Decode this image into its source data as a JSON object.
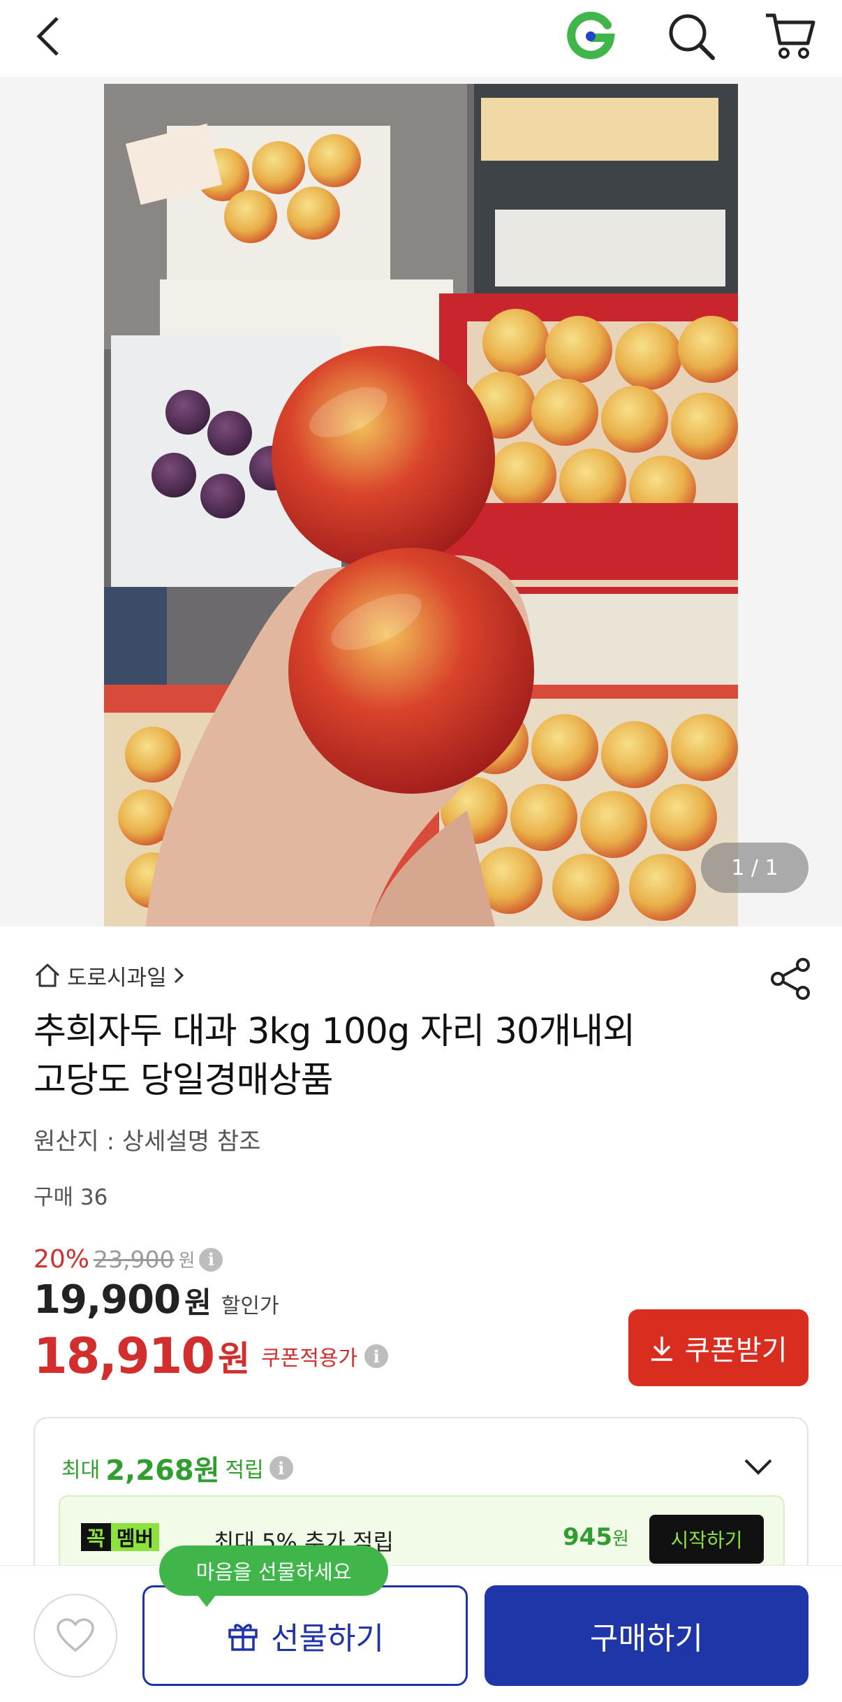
{
  "header": {
    "back_icon": "chevron-left-icon",
    "logo_icon": "g-logo-icon",
    "search_icon": "search-icon",
    "cart_icon": "cart-icon",
    "logo_color": "#3fb54a"
  },
  "gallery": {
    "counter": "1 / 1"
  },
  "product": {
    "seller": "도로시과일",
    "title_line1": "추희자두 대과 3kg 100g 자리 30개내외",
    "title_line2": "고당도 당일경매상품",
    "origin": "원산지 : 상세설명 참조",
    "purchases": "구매 36"
  },
  "price": {
    "discount_rate": "20%",
    "original": "23,900",
    "original_unit": "원",
    "sale": "19,900",
    "sale_unit": "원",
    "sale_label": "할인가",
    "coupon_price": "18,910",
    "coupon_unit": "원",
    "coupon_label": "쿠폰적용가",
    "coupon_button": "쿠폰받기",
    "accent_color": "#d22e2e"
  },
  "reward": {
    "prefix": "최대",
    "amount": "2,268원",
    "suffix": "적립",
    "member_badge1": "꼭",
    "member_badge2": "멤버",
    "member_text": "최대 5% 추가 적립",
    "member_amount": "945",
    "member_amount_unit": "원",
    "member_start": "시작하기"
  },
  "bottom_bar": {
    "tooltip": "마음을 선물하세요",
    "gift_label": "선물하기",
    "buy_label": "구매하기",
    "brand_color": "#1f36a9"
  }
}
